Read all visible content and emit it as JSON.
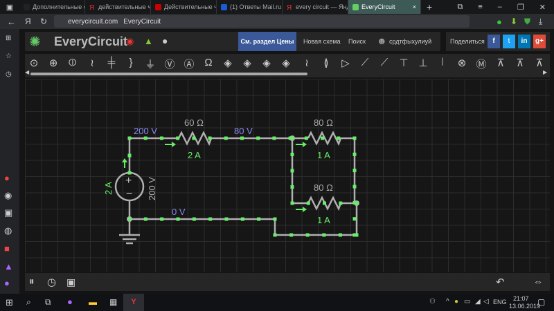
{
  "browser": {
    "tabs": [
      {
        "label": "Дополнительные св"
      },
      {
        "label": "действительные чис"
      },
      {
        "label": "Действительные чис"
      },
      {
        "label": "(1) Ответы Mail.ru: За"
      },
      {
        "label": "every circuit — Яндекс"
      },
      {
        "label": "EveryCircuit",
        "active": true
      }
    ],
    "url_domain": "everycircuit.com",
    "url_title": "EveryCircuit"
  },
  "app": {
    "logo": "EveryCircuit",
    "pricing_button": "См. раздел Цены",
    "new_schema": "Новая схема",
    "search": "Поиск",
    "user": "срдтфыхулиуй",
    "share": "Поделиться",
    "accent": "#3b5998"
  },
  "circuit": {
    "source_voltage": "200 V",
    "source_current": "2 A",
    "node_top": "200 V",
    "node_mid": "80 V",
    "node_ground": "0 V",
    "r1": "60 Ω",
    "r1_current": "2 A",
    "r2": "80 Ω",
    "r2_current": "1 A",
    "r3": "80 Ω",
    "r3_current": "1 A",
    "wire_color": "#b0b0b0",
    "current_color": "#66ee66",
    "voltage_color": "#8888ee"
  },
  "taskbar": {
    "lang": "ENG",
    "time": "21:07",
    "date": "13.06.2019"
  }
}
